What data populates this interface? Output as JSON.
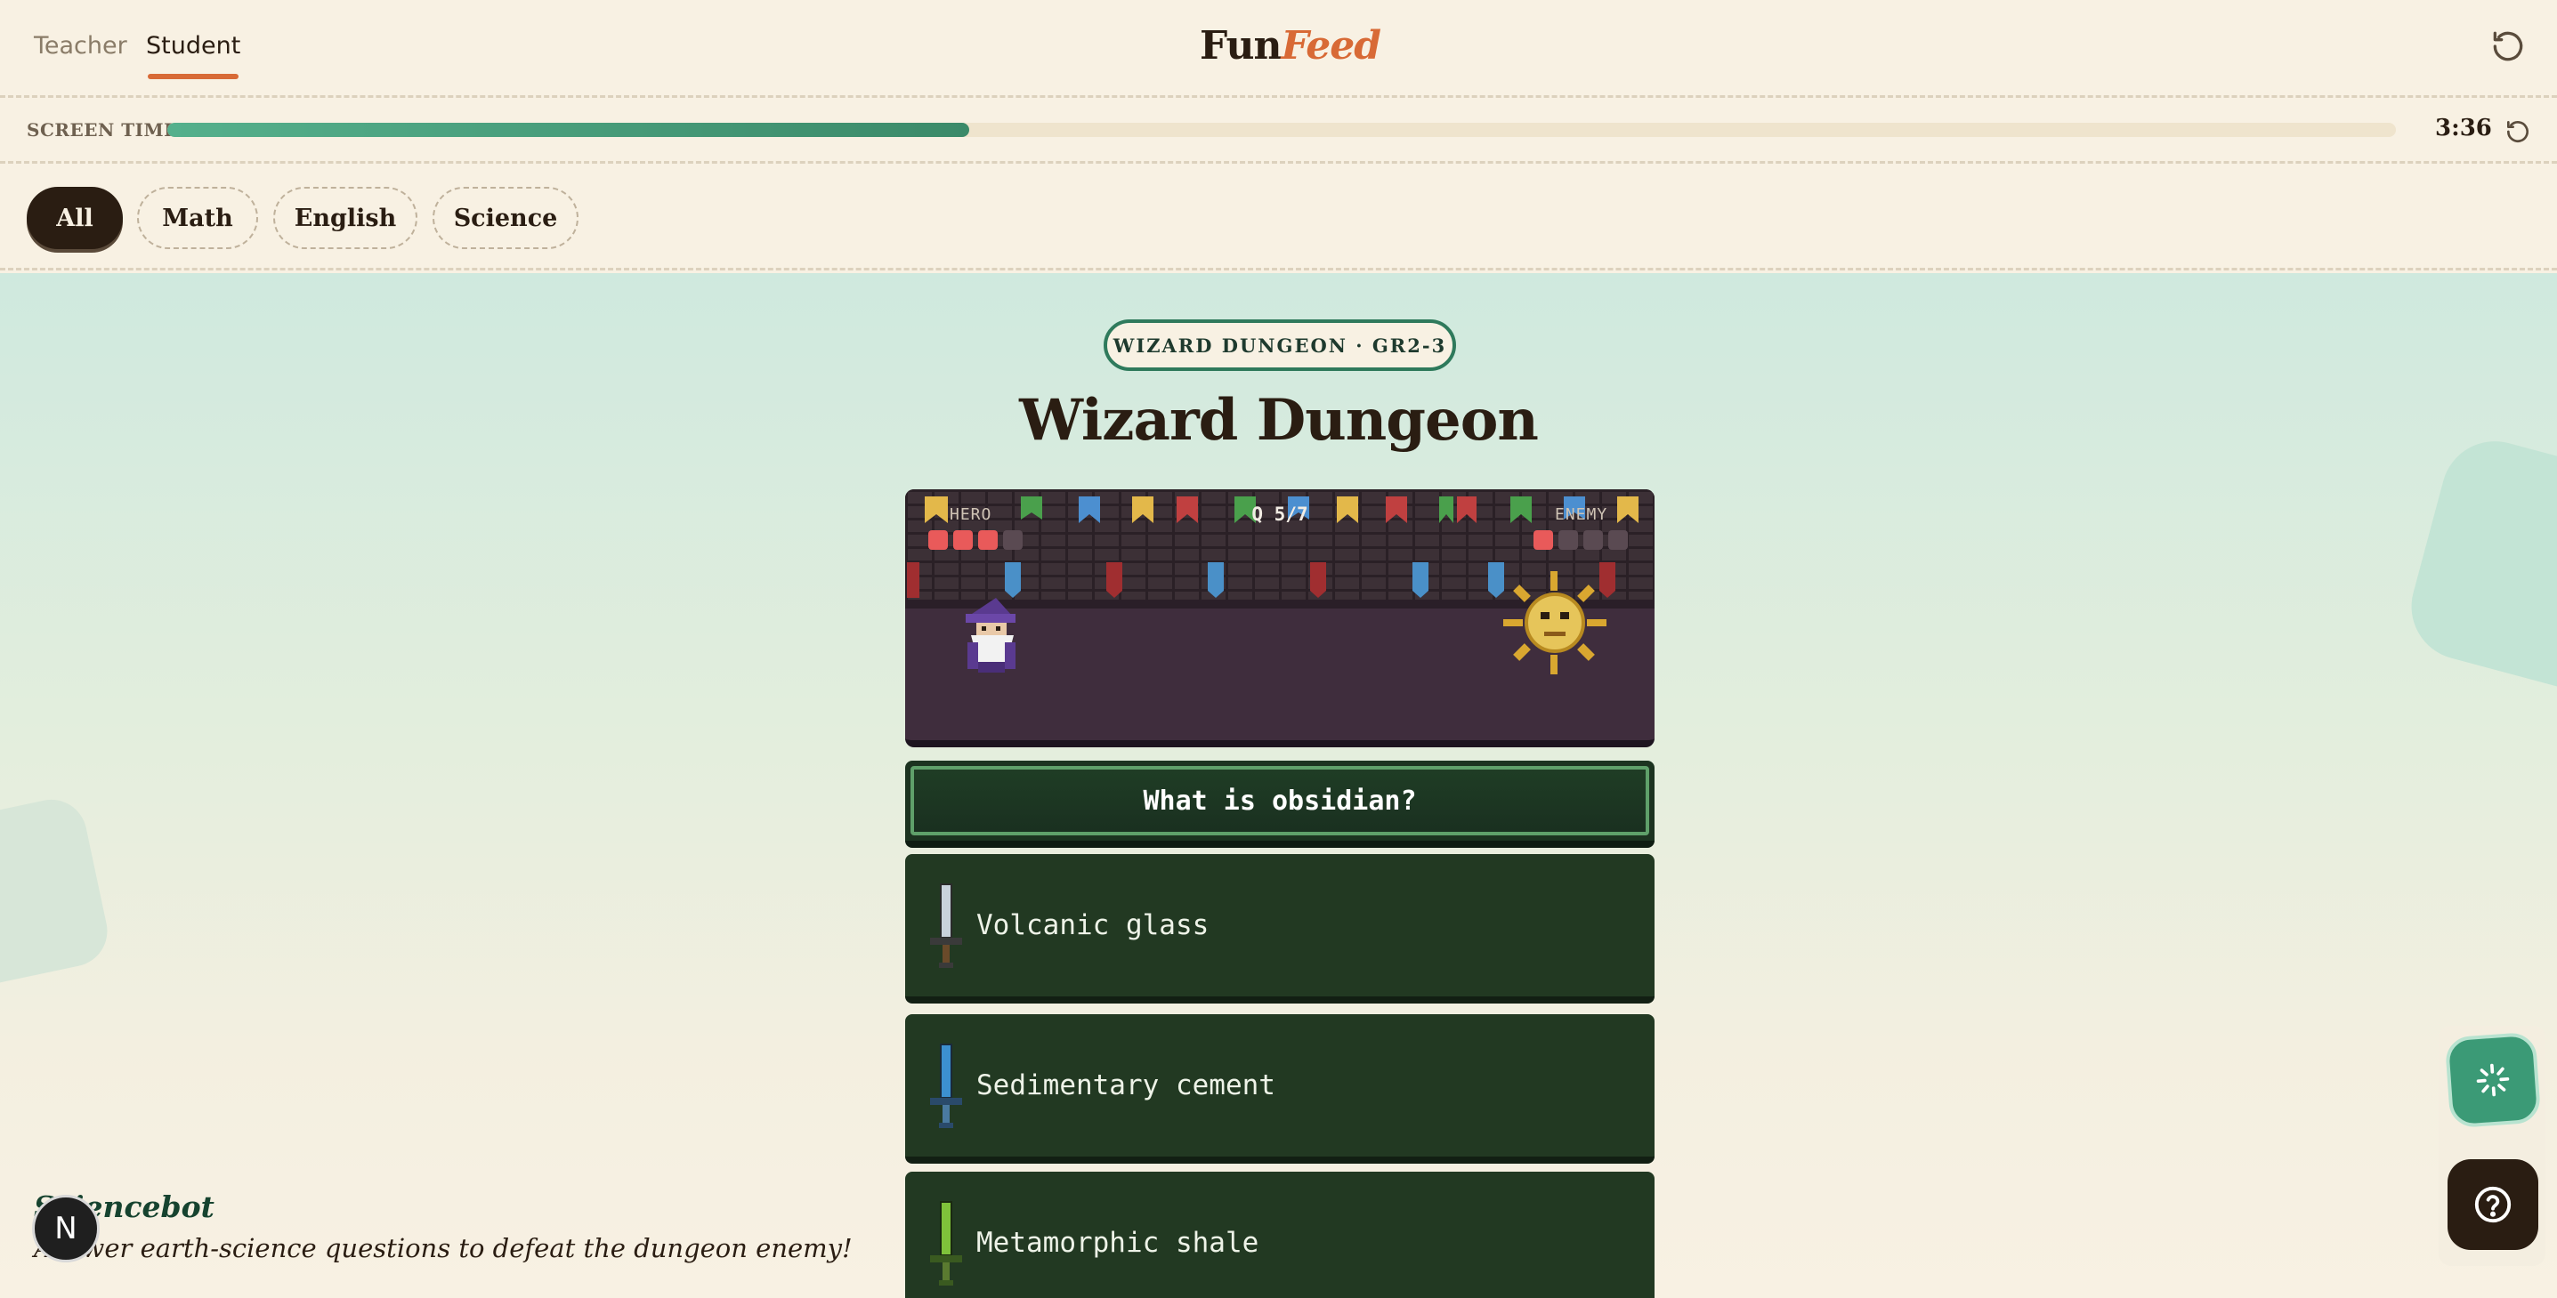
{
  "header": {
    "roles": [
      "Teacher",
      "Student"
    ],
    "active_role": "Student",
    "logo_fun": "Fun",
    "logo_feed": "Feed"
  },
  "screen_time": {
    "label": "SCREEN TIME",
    "progress": 0.36,
    "value": "3:36"
  },
  "filters": {
    "items": [
      "All",
      "Math",
      "English",
      "Science"
    ],
    "active": "All"
  },
  "game": {
    "badge": "WIZARD DUNGEON · GR2-3",
    "title": "Wizard Dungeon",
    "hud": {
      "hero_label": "HERO",
      "enemy_label": "ENEMY",
      "question_counter": "Q 5/7",
      "hero_hearts": 3,
      "hero_hearts_max": 4,
      "enemy_hearts": 1,
      "enemy_hearts_max": 4
    },
    "question": "What is obsidian?",
    "answers": [
      {
        "label": "Volcanic glass",
        "sword_color": "#c9d2dc"
      },
      {
        "label": "Sedimentary cement",
        "sword_color": "#3c8fd0"
      },
      {
        "label": "Metamorphic shale",
        "sword_color": "#7fc23a"
      }
    ]
  },
  "caption": {
    "title": "Sciencebot",
    "subtitle": "Answer earth-science questions to defeat the dungeon enemy!"
  },
  "badge_letter": "N",
  "colors": {
    "accent": "#d86a36",
    "brand_green": "#3b9a76",
    "background": "#f8f1e3"
  }
}
